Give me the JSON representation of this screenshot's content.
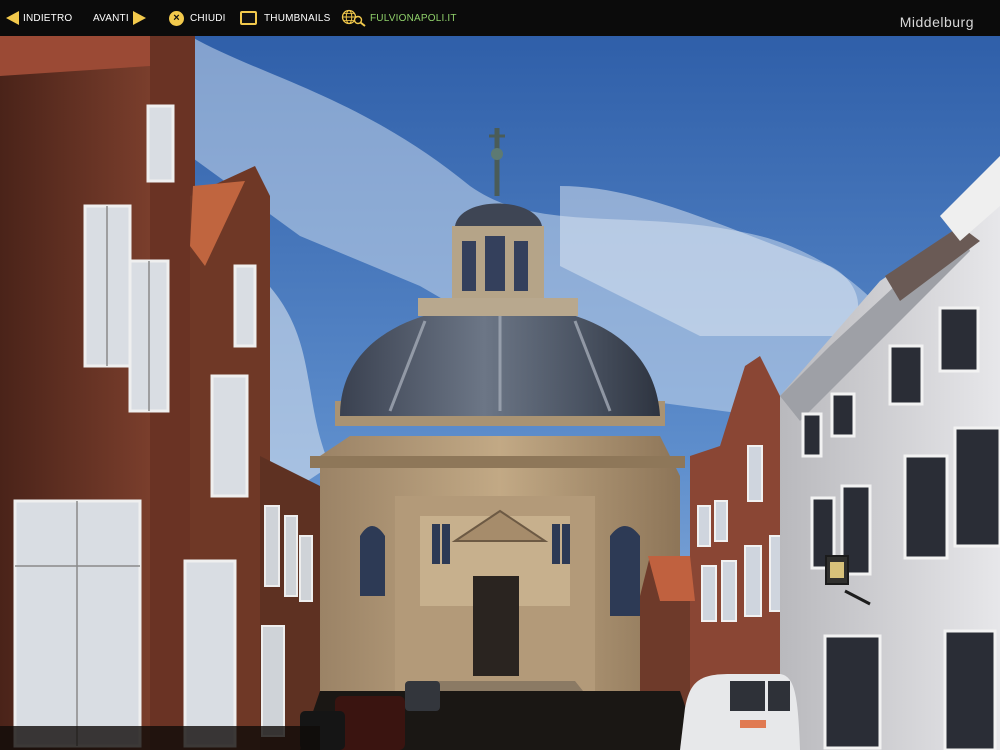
{
  "toolbar": {
    "back_label": "INDIETRO",
    "next_label": "AVANTI",
    "close_label": "CHIUDI",
    "thumbnails_label": "THUMBNAILS",
    "site_label": "FULVIONAPOLI.IT"
  },
  "title": "Middelburg",
  "icons": {
    "back": "arrow-left-icon",
    "next": "arrow-right-icon",
    "close": "close-circle-icon",
    "thumbnails": "thumbnails-icon",
    "site": "globe-search-icon"
  },
  "colors": {
    "accent": "#f2c94c",
    "site_link": "#8fd06a",
    "toolbar_bg": "#0b0b0b"
  },
  "photo": {
    "subject": "octagonal domed church"
  }
}
